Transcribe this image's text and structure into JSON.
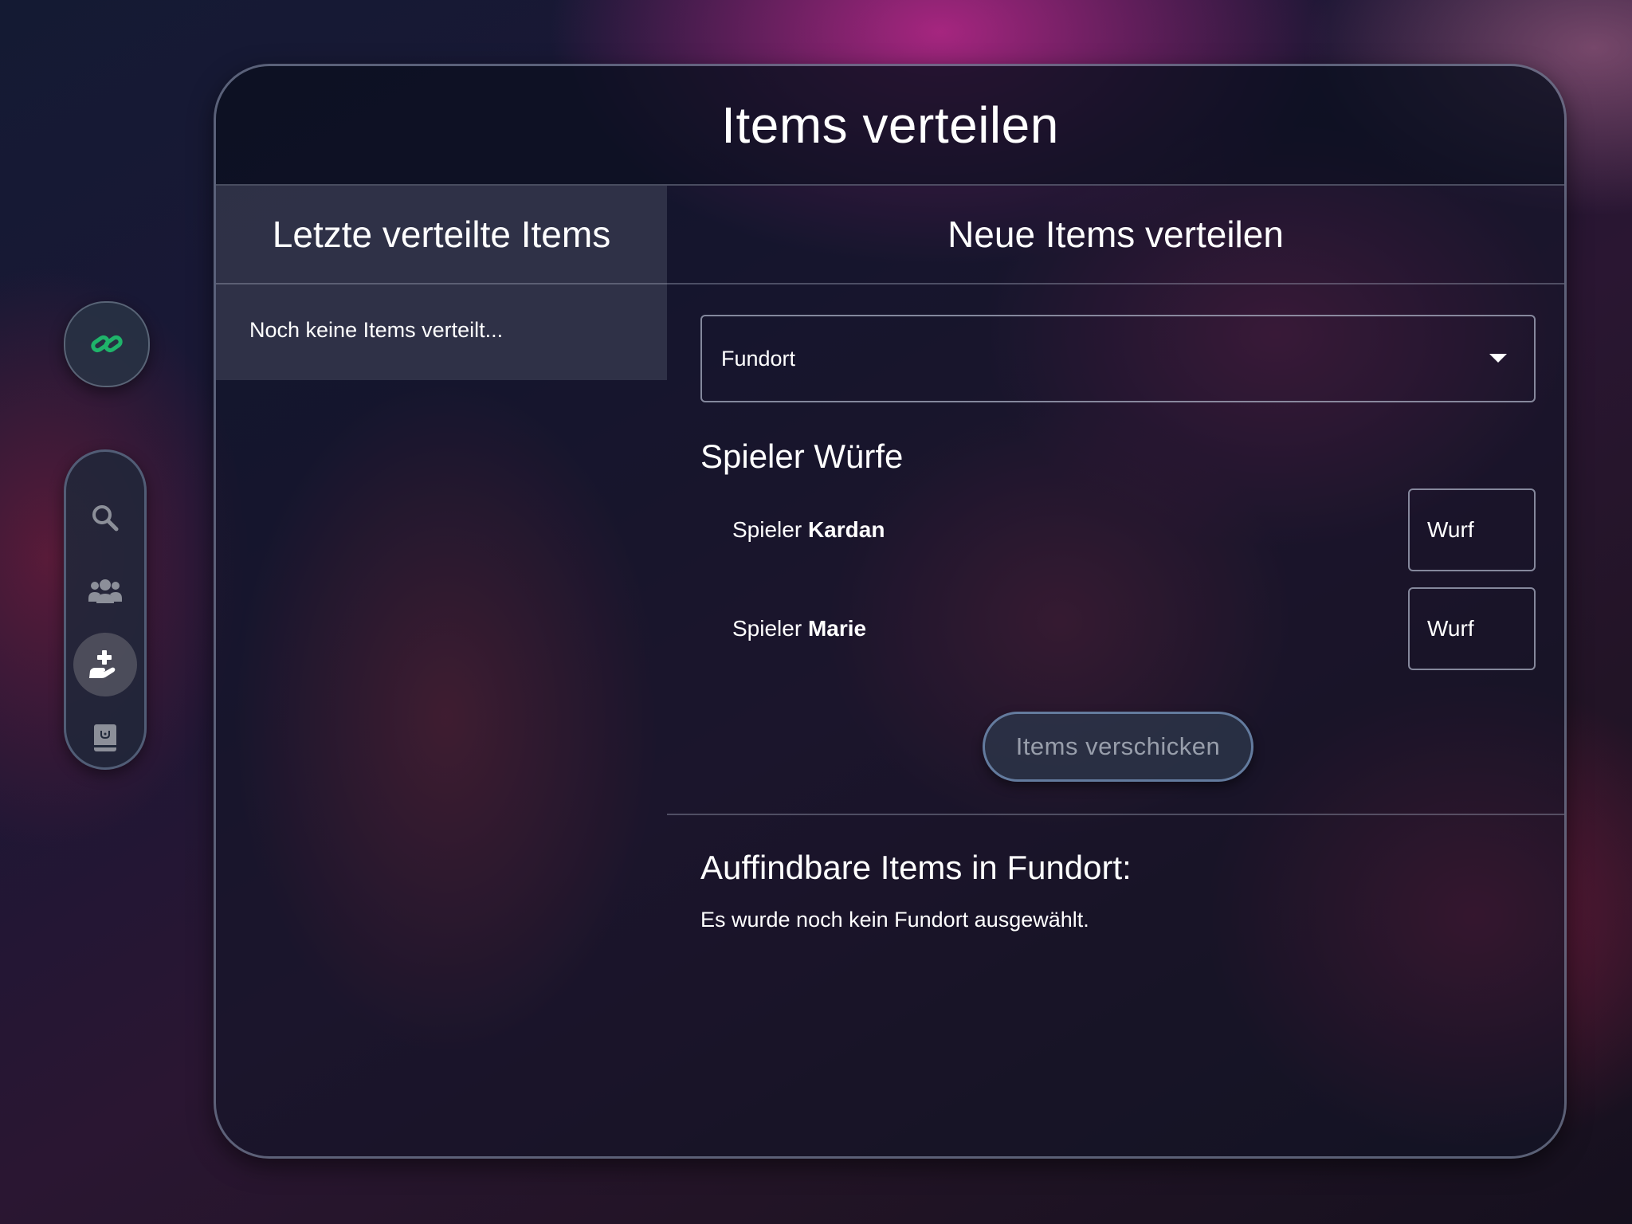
{
  "card": {
    "title": "Items verteilen"
  },
  "left_panel": {
    "heading": "Letzte verteilte Items",
    "empty_text": "Noch keine Items verteilt..."
  },
  "right_panel": {
    "heading": "Neue Items verteilen",
    "location_select": {
      "value": "Fundort"
    },
    "rolls_heading": "Spieler Würfe",
    "players": [
      {
        "prefix": "Spieler",
        "name": "Kardan",
        "roll_placeholder": "Wurf"
      },
      {
        "prefix": "Spieler",
        "name": "Marie",
        "roll_placeholder": "Wurf"
      }
    ],
    "send_button_label": "Items verschicken",
    "findable_heading": "Auffindbare Items in Fundort:",
    "findable_text": "Es wurde noch kein Fundort ausgewählt."
  },
  "sidebar": {
    "top_icon": "link-icon",
    "nav_items": [
      {
        "icon": "search-icon",
        "active": false
      },
      {
        "icon": "users-icon",
        "active": false
      },
      {
        "icon": "hand-plus-icon",
        "active": true
      },
      {
        "icon": "book-icon",
        "active": false
      }
    ]
  },
  "colors": {
    "link_icon": "#1fb46a",
    "nav_icon": "#8c8f99",
    "active_icon": "#ffffff"
  }
}
